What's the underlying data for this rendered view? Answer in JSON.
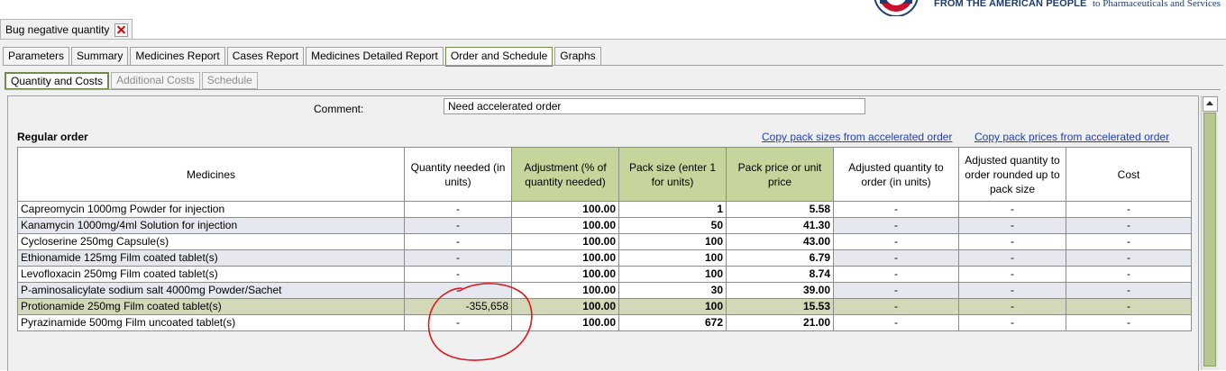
{
  "branding": {
    "usaid_tagline": "FROM THE AMERICAN PEOPLE",
    "sps_tagline": "to Pharmaceuticals and Services"
  },
  "window_tab": {
    "label": "Bug negative quantity"
  },
  "main_tabs": [
    {
      "label": "Parameters"
    },
    {
      "label": "Summary"
    },
    {
      "label": "Medicines Report"
    },
    {
      "label": "Cases Report"
    },
    {
      "label": "Medicines Detailed Report"
    },
    {
      "label": "Order and Schedule",
      "active": true
    },
    {
      "label": "Graphs"
    }
  ],
  "sub_tabs": [
    {
      "label": "Quantity and Costs",
      "active": true
    },
    {
      "label": "Additional Costs",
      "enabled": false
    },
    {
      "label": "Schedule",
      "enabled": false
    }
  ],
  "comment": {
    "label": "Comment:",
    "value": "Need accelerated order"
  },
  "section": {
    "title": "Regular order"
  },
  "links": {
    "copy_pack_sizes": "Copy pack sizes from accelerated order",
    "copy_pack_prices": "Copy pack prices from accelerated order"
  },
  "table": {
    "headers": [
      "Medicines",
      "Quantity needed (in units)",
      "Adjustment (% of quantity needed)",
      "Pack size (enter 1 for units)",
      "Pack price or unit price",
      "Adjusted quantity to order (in units)",
      "Adjusted quantity to order rounded up to pack size",
      "Cost"
    ],
    "rows": [
      [
        "Capreomycin  1000mg  Powder for injection",
        "-",
        "100.00",
        "1",
        "5.58",
        "-",
        "-",
        "-"
      ],
      [
        "Kanamycin  1000mg/4ml  Solution for injection",
        "-",
        "100.00",
        "50",
        "41.30",
        "-",
        "-",
        "-"
      ],
      [
        "Cycloserine  250mg  Capsule(s)",
        "-",
        "100.00",
        "100",
        "43.00",
        "-",
        "-",
        "-"
      ],
      [
        "Ethionamide  125mg  Film coated tablet(s)",
        "-",
        "100.00",
        "100",
        "6.79",
        "-",
        "-",
        "-"
      ],
      [
        "Levofloxacin  250mg  Film coated tablet(s)",
        "-",
        "100.00",
        "100",
        "8.74",
        "-",
        "-",
        "-"
      ],
      [
        "P-aminosalicylate sodium salt  4000mg  Powder/Sachet",
        "-",
        "100.00",
        "30",
        "39.00",
        "-",
        "-",
        "-"
      ],
      [
        "Protionamide   250mg  Film coated tablet(s)",
        "-355,658",
        "100.00",
        "100",
        "15.53",
        "-",
        "-",
        "-"
      ],
      [
        "Pyrazinamide  500mg  Film uncoated tablet(s)",
        "-",
        "100.00",
        "672",
        "21.00",
        "-",
        "-",
        "-"
      ]
    ],
    "selected_row": 6
  },
  "colors": {
    "editable_header": "#c6d59c",
    "selected_row": "#d3d9b8",
    "alt_row": "#e6e8ef",
    "link": "#1f3fbf",
    "annotation": "#e0141c"
  }
}
